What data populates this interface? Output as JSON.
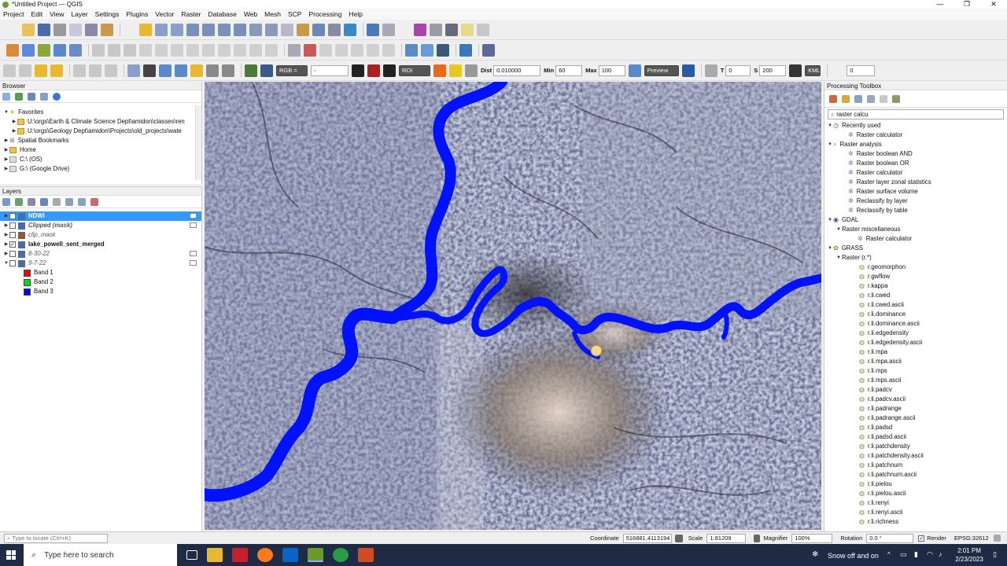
{
  "window": {
    "title": "*Untitled Project — QGIS",
    "min": "—",
    "max": "❐",
    "close": "✕"
  },
  "menu": [
    "Project",
    "Edit",
    "View",
    "Layer",
    "Settings",
    "Plugins",
    "Vector",
    "Raster",
    "Database",
    "Web",
    "Mesh",
    "SCP",
    "Processing",
    "Help"
  ],
  "scp_toolbar": {
    "rgb_label": "RGB =",
    "rgb_value": "-",
    "roi_label": "ROI",
    "dist_label": "Dist",
    "dist_value": "0.010000",
    "min_label": "Min",
    "min_value": "60",
    "max_label": "Max",
    "max_value": "100",
    "preview_label": "Preview",
    "t_label": "T",
    "t_value": "0",
    "s_label": "S",
    "s_value": "200",
    "kml_label": "KML",
    "last_value": "0"
  },
  "browser": {
    "title": "Browser",
    "items": [
      {
        "label": "Favorites",
        "level": 0,
        "expanded": true,
        "icon": "star-icon"
      },
      {
        "label": "U:\\orgs\\Earth & Climate Science Dept\\amidon\\classes\\ren",
        "level": 1,
        "icon": "folder-icon"
      },
      {
        "label": "U:\\orgs\\Geology Dept\\amidon\\Projects\\old_projects\\wate",
        "level": 1,
        "icon": "folder-icon"
      },
      {
        "label": "Spatial Bookmarks",
        "level": 0,
        "icon": "bookmark-icon"
      },
      {
        "label": "Home",
        "level": 0,
        "icon": "folder-icon"
      },
      {
        "label": "C:\\ (OS)",
        "level": 0,
        "icon": "drive-icon"
      },
      {
        "label": "G:\\ (Google Drive)",
        "level": 0,
        "icon": "drive-icon"
      }
    ]
  },
  "layers": {
    "title": "Layers",
    "items": [
      {
        "label": "NDWI",
        "checked": true,
        "selected": true,
        "bold": true,
        "italic": false
      },
      {
        "label": "Clipped (mask)",
        "checked": false,
        "bold": true,
        "italic": true
      },
      {
        "label": "clip_mask",
        "checked": false,
        "bold": false,
        "italic": true
      },
      {
        "label": "lake_powell_sent_merged",
        "checked": true,
        "bold": true,
        "italic": false
      },
      {
        "label": "8-30-22",
        "checked": false,
        "bold": false,
        "italic": true
      },
      {
        "label": "9-7-22",
        "checked": false,
        "bold": false,
        "italic": true
      }
    ],
    "bands": [
      {
        "label": "Band 1",
        "color": "#ff0000"
      },
      {
        "label": "Band 2",
        "color": "#00dd00"
      },
      {
        "label": "Band 3",
        "color": "#0000ff"
      }
    ]
  },
  "processing": {
    "title": "Processing Toolbox",
    "search_value": "raster calcu",
    "groups": [
      {
        "label": "Recently used",
        "items": [
          "Raster calculator"
        ]
      },
      {
        "label": "Raster analysis",
        "items": [
          "Raster boolean AND",
          "Raster boolean OR",
          "Raster calculator",
          "Raster layer zonal statistics",
          "Raster surface volume",
          "Reclassify by layer",
          "Reclassify by table"
        ]
      },
      {
        "label": "GDAL",
        "sub": "Raster miscellaneous",
        "items": [
          "Raster calculator"
        ]
      },
      {
        "label": "GRASS",
        "sub": "Raster (r.*)",
        "items": [
          "r.geomorphon",
          "r.gwflow",
          "r.kappa",
          "r.li.cwed",
          "r.li.cwed.ascii",
          "r.li.dominance",
          "r.li.dominance.ascii",
          "r.li.edgedensity",
          "r.li.edgedensity.ascii",
          "r.li.mpa",
          "r.li.mpa.ascii",
          "r.li.mps",
          "r.li.mps.ascii",
          "r.li.padcv",
          "r.li.padcv.ascii",
          "r.li.padrange",
          "r.li.padrange.ascii",
          "r.li.padsd",
          "r.li.padsd.ascii",
          "r.li.patchdensity",
          "r.li.patchdensity.ascii",
          "r.li.patchnum",
          "r.li.patchnum.ascii",
          "r.li.pielou",
          "r.li.pielou.ascii",
          "r.li.renyi",
          "r.li.renyi.ascii",
          "r.li.richness"
        ]
      }
    ]
  },
  "status": {
    "locate_placeholder": "Type to locate (Ctrl+K)",
    "coordinate_label": "Coordinate",
    "coordinate_value": "516881,4113194",
    "scale_label": "Scale",
    "scale_value": "1:81209",
    "magnifier_label": "Magnifier",
    "magnifier_value": "100%",
    "rotation_label": "Rotation",
    "rotation_value": "0.0 °",
    "render_label": "Render",
    "crs": "EPSG:32612"
  },
  "taskbar": {
    "search_placeholder": "Type here to search",
    "weather": "Snow off and on",
    "time": "2:01 PM",
    "date": "2/23/2023"
  },
  "colors": {
    "water": "#0011ff",
    "selection": "#3399ff",
    "qgis_green": "#6a9a2c"
  }
}
